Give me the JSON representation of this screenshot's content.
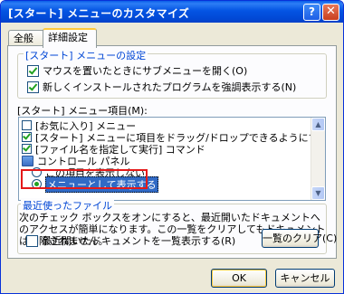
{
  "window": {
    "title": "[スタート] メニューのカスタマイズ",
    "help_glyph": "?",
    "close_glyph": "✕"
  },
  "tabs": [
    {
      "label": "全般"
    },
    {
      "label": "詳細設定"
    }
  ],
  "start_menu_settings": {
    "legend": "[スタート] メニューの設定",
    "options": [
      {
        "label": "マウスを置いたときにサブメニューを開く(O)",
        "checked": true
      },
      {
        "label": "新しくインストールされたプログラムを強調表示する(N)",
        "checked": true
      }
    ]
  },
  "items_list": {
    "label": "[スタート] メニュー項目(M):",
    "items": [
      {
        "type": "checkbox",
        "label": "[お気に入り] メニュー",
        "checked": false
      },
      {
        "type": "checkbox",
        "label": "[スタート] メニューに項目をドラッグ/ドロップできるようにする",
        "checked": true
      },
      {
        "type": "checkbox",
        "label": "[ファイル名を指定して実行] コマンド",
        "checked": true
      },
      {
        "type": "category",
        "label": "コントロール パネル",
        "icon": "control-panel-icon"
      },
      {
        "type": "radio",
        "label": "この項目を表示しない",
        "selected": false
      },
      {
        "type": "radio",
        "label": "メニューとして表示する",
        "selected": true
      }
    ],
    "scroll_up_glyph": "▲",
    "scroll_down_glyph": "▼"
  },
  "recent_documents": {
    "legend": "最近使ったファイル",
    "description": "次のチェック ボックスをオンにすると、最近開いたドキュメントへのアクセスが簡単になります。この一覧をクリアしてもドキュメントは削除されません。",
    "list_checkbox_label": "最近開いたドキュメントを一覧表示する(R)",
    "list_checkbox_checked": false,
    "clear_button": "一覧のクリア(C)"
  },
  "footer": {
    "ok_label": "OK",
    "cancel_label": "キャンセル"
  },
  "colors": {
    "accent_blue": "#0046d5",
    "highlight_red": "#e41919",
    "selection": "#316ac5"
  }
}
